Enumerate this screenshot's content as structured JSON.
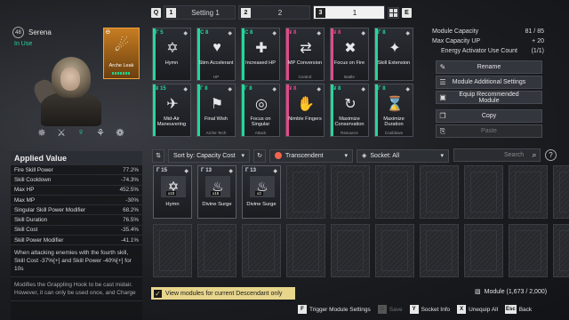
{
  "tabs": {
    "prev_key": "Q",
    "next_key": "E",
    "items": [
      {
        "num": "1",
        "label": "Setting 1"
      },
      {
        "num": "2",
        "label": "2"
      },
      {
        "num": "3",
        "label": "1"
      }
    ]
  },
  "character": {
    "level": "48",
    "name": "Serena",
    "status": "In Use",
    "core_module": {
      "name": "Arche Leak",
      "badge": "ϴ"
    }
  },
  "capacity": {
    "module_capacity_label": "Module Capacity",
    "module_capacity_value": "81 / 85",
    "max_capacity_label": "Max Capacity UP",
    "max_capacity_value": "+ 20",
    "activator_label": "Energy Activator Use Count",
    "activator_value": "(1/1)"
  },
  "right_buttons": [
    {
      "label": "Rename",
      "icon": "pencil-icon"
    },
    {
      "label": "Module Additional Settings",
      "icon": "sliders-icon"
    },
    {
      "label": "Equip Recommended Module",
      "icon": "equip-icon"
    },
    {
      "label": "Copy",
      "icon": "copy-icon"
    },
    {
      "label": "Paste",
      "icon": "paste-icon"
    }
  ],
  "equipped": [
    {
      "cap": "Γ 5",
      "name": "Hymn",
      "cat": "",
      "color": "#26d69b",
      "glyph": "✡"
    },
    {
      "cap": "C 8",
      "name": "Stim Accelerant",
      "cat": "HP",
      "color": "#26d69b",
      "glyph": "♥"
    },
    {
      "cap": "C 8",
      "name": "Increased HP",
      "cat": "",
      "color": "#26d69b",
      "glyph": "✚"
    },
    {
      "cap": "¥ 8",
      "name": "MP Conversion",
      "cat": "Control",
      "color": "#e24a8a",
      "glyph": "⇄"
    },
    {
      "cap": "¥ 8",
      "name": "Focus on Fire",
      "cat": "Battle",
      "color": "#e24a8a",
      "glyph": "✖"
    },
    {
      "cap": "Γ 8",
      "name": "Skill Extension",
      "cat": "",
      "color": "#26d69b",
      "glyph": "✦"
    },
    {
      "cap": "¥ 15",
      "name": "Mid-Air Maneuvering",
      "cat": "",
      "color": "#26d69b",
      "glyph": "✈"
    },
    {
      "cap": "Γ 8",
      "name": "Final Wish",
      "cat": "Arche Tech",
      "color": "#26d69b",
      "glyph": "⚑"
    },
    {
      "cap": "Γ 8",
      "name": "Focus on Singular",
      "cat": "Attack",
      "color": "#26d69b",
      "glyph": "◎"
    },
    {
      "cap": "¥ 8",
      "name": "Nimble Fingers",
      "cat": "",
      "color": "#e24a8a",
      "glyph": "✋"
    },
    {
      "cap": "¥ 8",
      "name": "Maximize Conservation",
      "cat": "Resource",
      "color": "#26d69b",
      "glyph": "↻"
    },
    {
      "cap": "Γ 8",
      "name": "Maximize Duration",
      "cat": "Cooldown",
      "color": "#26d69b",
      "glyph": "⌛"
    }
  ],
  "applied": {
    "title": "Applied Value",
    "rows": [
      {
        "k": "Fire Skill Power",
        "v": "77.2%"
      },
      {
        "k": "Skill Cooldown",
        "v": "-74.3%"
      },
      {
        "k": "Max HP",
        "v": "452.5%"
      },
      {
        "k": "Max MP",
        "v": "-30%"
      },
      {
        "k": "Singular Skill Power Modifier",
        "v": "68.2%"
      },
      {
        "k": "Skill Duration",
        "v": "76.5%"
      },
      {
        "k": "Skill Cost",
        "v": "-35.4%"
      },
      {
        "k": "Skill Power Modifier",
        "v": "-41.1%"
      }
    ],
    "desc1": "When attacking enemies with the fourth skill, Skill Cost -37%[+] and Skill Power -40%[+] for 10s",
    "desc2": "Modifies the Grappling Hook to be cast midair. However, it can only be used once, and Charge"
  },
  "filters": {
    "sort": "Sort by: Capacity Cost",
    "tier": "Transcendent",
    "socket": "Socket: All",
    "search_placeholder": "Search"
  },
  "inventory": [
    {
      "cap": "Γ 15",
      "name": "Hymn",
      "qty": "x10",
      "glyph": "✡"
    },
    {
      "cap": "Γ 13",
      "name": "Divine Surge",
      "qty": "x15",
      "glyph": "♨"
    },
    {
      "cap": "Γ 13",
      "name": "Divine Surge",
      "qty": "x3",
      "glyph": "♨"
    }
  ],
  "footer": {
    "checkbox_label": "View modules for current Descendant only",
    "module_count": "Module (1,673 / 2,000)",
    "hints": [
      {
        "key": "F",
        "label": "Trigger Module Settings",
        "disabled": false
      },
      {
        "key": "□",
        "label": "Save",
        "disabled": true
      },
      {
        "key": "Y",
        "label": "Socket Info",
        "disabled": false
      },
      {
        "key": "X",
        "label": "Unequip All",
        "disabled": false
      },
      {
        "key": "Esc",
        "label": "Back",
        "disabled": false
      }
    ]
  },
  "colors": {
    "accent_green": "#26d69b",
    "core_orange": "#f2a23a",
    "highlight_yellow": "#e8d68c"
  }
}
